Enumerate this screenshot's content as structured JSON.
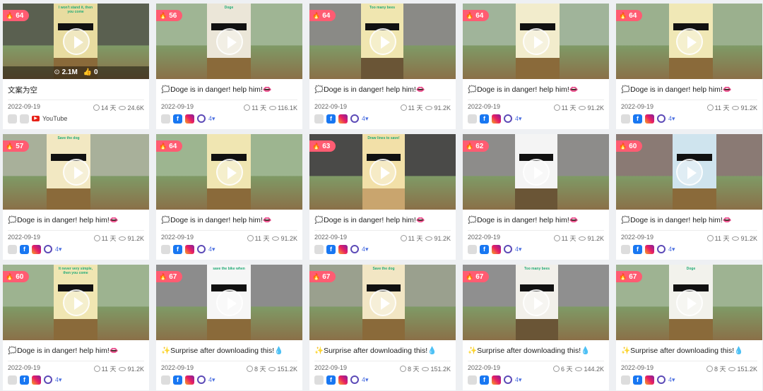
{
  "cards": [
    {
      "heat": "64",
      "title": "文案为空",
      "date": "2022-09-19",
      "days": "14 天",
      "views": "24.6K",
      "overlay_views": "2.1M",
      "overlay_likes": "0",
      "platform_text": "YouTube",
      "more": "",
      "bg": "#5a6050",
      "phone": "#e8dca0",
      "phone_text": "I won't stand it, then you come"
    },
    {
      "heat": "56",
      "title": "🗯️Doge is in danger! help him!👄",
      "date": "2022-09-19",
      "days": "11 天",
      "views": "116.1K",
      "more": "4",
      "bg": "#9fb594",
      "phone": "#ebe6d8",
      "phone_text": "Doge"
    },
    {
      "heat": "64",
      "title": "🗯️Doge is in danger! help him!👄",
      "date": "2022-09-19",
      "days": "11 天",
      "views": "91.2K",
      "more": "4",
      "bg": "#8a8a86",
      "phone": "#f0e6b0",
      "phone_text": "Too many bees"
    },
    {
      "heat": "64",
      "title": "🗯️Doge is in danger! help him!👄",
      "date": "2022-09-19",
      "days": "11 天",
      "views": "91.2K",
      "more": "4",
      "bg": "#a0b49a",
      "phone": "#f2eccc",
      "phone_text": ""
    },
    {
      "heat": "64",
      "title": "🗯️Doge is in danger! help him!👄",
      "date": "2022-09-19",
      "days": "11 天",
      "views": "91.2K",
      "more": "4",
      "bg": "#9bb08e",
      "phone": "#f0e8b6",
      "phone_text": ""
    },
    {
      "heat": "57",
      "title": "🗯️Doge is in danger! help him!👄",
      "date": "2022-09-19",
      "days": "11 天",
      "views": "91.2K",
      "more": "4",
      "bg": "#a8b09a",
      "phone": "#f2e8c2",
      "phone_text": "Save the dog"
    },
    {
      "heat": "64",
      "title": "🗯️Doge is in danger! help him!👄",
      "date": "2022-09-19",
      "days": "11 天",
      "views": "91.2K",
      "more": "4",
      "bg": "#9db590",
      "phone": "#f0e6b2",
      "phone_text": ""
    },
    {
      "heat": "63",
      "title": "🗯️Doge is in danger! help him!👄",
      "date": "2022-09-19",
      "days": "11 天",
      "views": "91.2K",
      "more": "4",
      "bg": "#4a4a48",
      "phone": "#f2e0a8",
      "phone_text": "Draw lines to save!"
    },
    {
      "heat": "62",
      "title": "🗯️Doge is in danger! help him!👄",
      "date": "2022-09-19",
      "days": "11 天",
      "views": "91.2K",
      "more": "4",
      "bg": "#8d8c8a",
      "phone": "#f4f4f4",
      "phone_text": ""
    },
    {
      "heat": "60",
      "title": "🗯️Doge is in danger! help him!👄",
      "date": "2022-09-19",
      "days": "11 天",
      "views": "91.2K",
      "more": "4",
      "bg": "#8a7a74",
      "phone": "#cfe4ee",
      "phone_text": ""
    },
    {
      "heat": "60",
      "title": "🗯️Doge is in danger! help him!👄",
      "date": "2022-09-19",
      "days": "11 天",
      "views": "91.2K",
      "more": "4",
      "bg": "#9db390",
      "phone": "#f0e6b2",
      "phone_text": "It never very simple, then you come"
    },
    {
      "heat": "67",
      "title": "✨Surprise after downloading this!💧",
      "date": "2022-09-19",
      "days": "8 天",
      "views": "151.2K",
      "more": "4",
      "bg": "#8c8c8c",
      "phone": "#f6f6f6",
      "phone_text": "save the bike when"
    },
    {
      "heat": "67",
      "title": "✨Surprise after downloading this!💧",
      "date": "2022-09-19",
      "days": "8 天",
      "views": "151.2K",
      "more": "4",
      "bg": "#9aa08e",
      "phone": "#f2e6c4",
      "phone_text": "Save the dog"
    },
    {
      "heat": "67",
      "title": "✨Surprise after downloading this!💧",
      "date": "2022-09-19",
      "days": "6 天",
      "views": "144.2K",
      "more": "4",
      "bg": "#8f8f8f",
      "phone": "#f2f0ea",
      "phone_text": "Too many bees"
    },
    {
      "heat": "67",
      "title": "✨Surprise after downloading this!💧",
      "date": "2022-09-19",
      "days": "8 天",
      "views": "151.2K",
      "more": "4",
      "bg": "#9eb392",
      "phone": "#f2f2ec",
      "phone_text": "Doge"
    }
  ],
  "icons": {
    "heat": "fire-icon",
    "time": "clock-icon",
    "views": "eye-icon",
    "apple": "apple-icon",
    "android": "android-icon",
    "facebook": "facebook-icon",
    "instagram": "instagram-icon",
    "audience": "audience-network-icon",
    "youtube": "youtube-icon",
    "play": "play-icon"
  }
}
